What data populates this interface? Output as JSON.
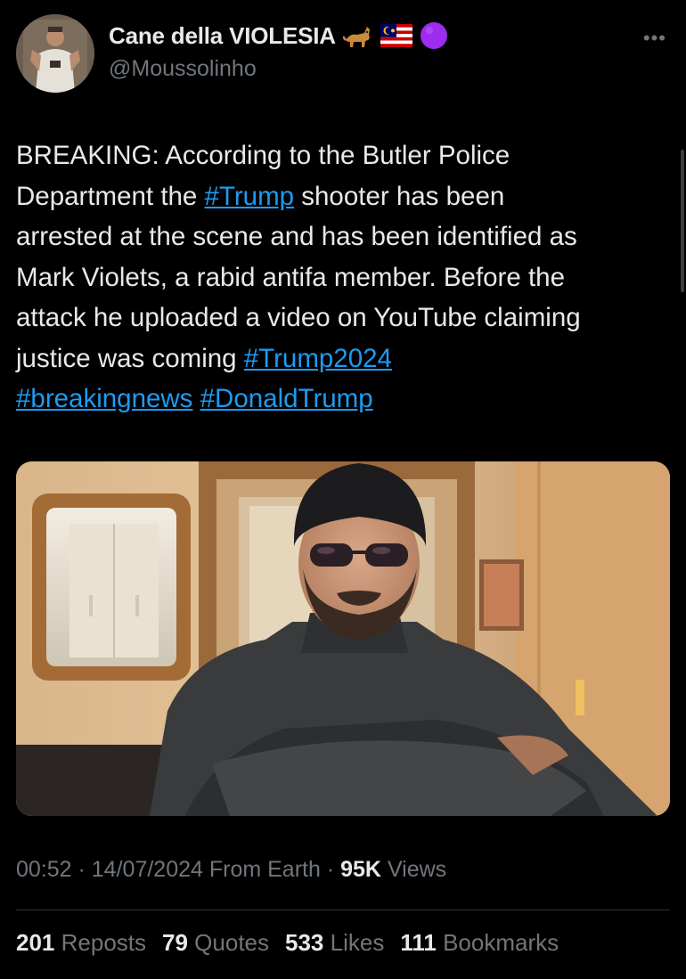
{
  "author": {
    "display_name": "Cane della VIOLESIA",
    "handle": "@Moussolinho",
    "emoji_badges": [
      "dog-emoji",
      "malaysia-flag-emoji",
      "purple-circle-emoji"
    ]
  },
  "more_label": "•••",
  "tweet": {
    "lines": [
      [
        {
          "t": "BREAKING: According to the Butler Police"
        }
      ],
      [
        {
          "t": "Department the "
        },
        {
          "h": "#Trump"
        },
        {
          "t": " shooter has been"
        }
      ],
      [
        {
          "t": "arrested at the scene and has been identified as"
        }
      ],
      [
        {
          "t": "Mark Violets, a rabid antifa member. Before the"
        }
      ],
      [
        {
          "t": "attack he uploaded a video on YouTube claiming"
        }
      ],
      [
        {
          "t": "justice was coming "
        },
        {
          "h": "#Trump2024"
        }
      ],
      [
        {
          "h": "#breakingnews"
        },
        {
          "t": " "
        },
        {
          "h": "#DonaldTrump"
        }
      ]
    ]
  },
  "media": {
    "kind": "video-still",
    "subject": "man in beanie and sunglasses with crossed arms"
  },
  "meta": {
    "time": "00:52",
    "date": "14/07/2024",
    "source": "From Earth",
    "views_count": "95K",
    "views_label": "Views",
    "sep": " · "
  },
  "stats": {
    "reposts_count": "201",
    "reposts_label": "Reposts",
    "quotes_count": "79",
    "quotes_label": "Quotes",
    "likes_count": "533",
    "likes_label": "Likes",
    "bookmarks_count": "111",
    "bookmarks_label": "Bookmarks"
  },
  "colors": {
    "background": "#000000",
    "text": "#e7e9ea",
    "muted": "#71767b",
    "link": "#1d9bf0",
    "divider": "#2f3336"
  }
}
